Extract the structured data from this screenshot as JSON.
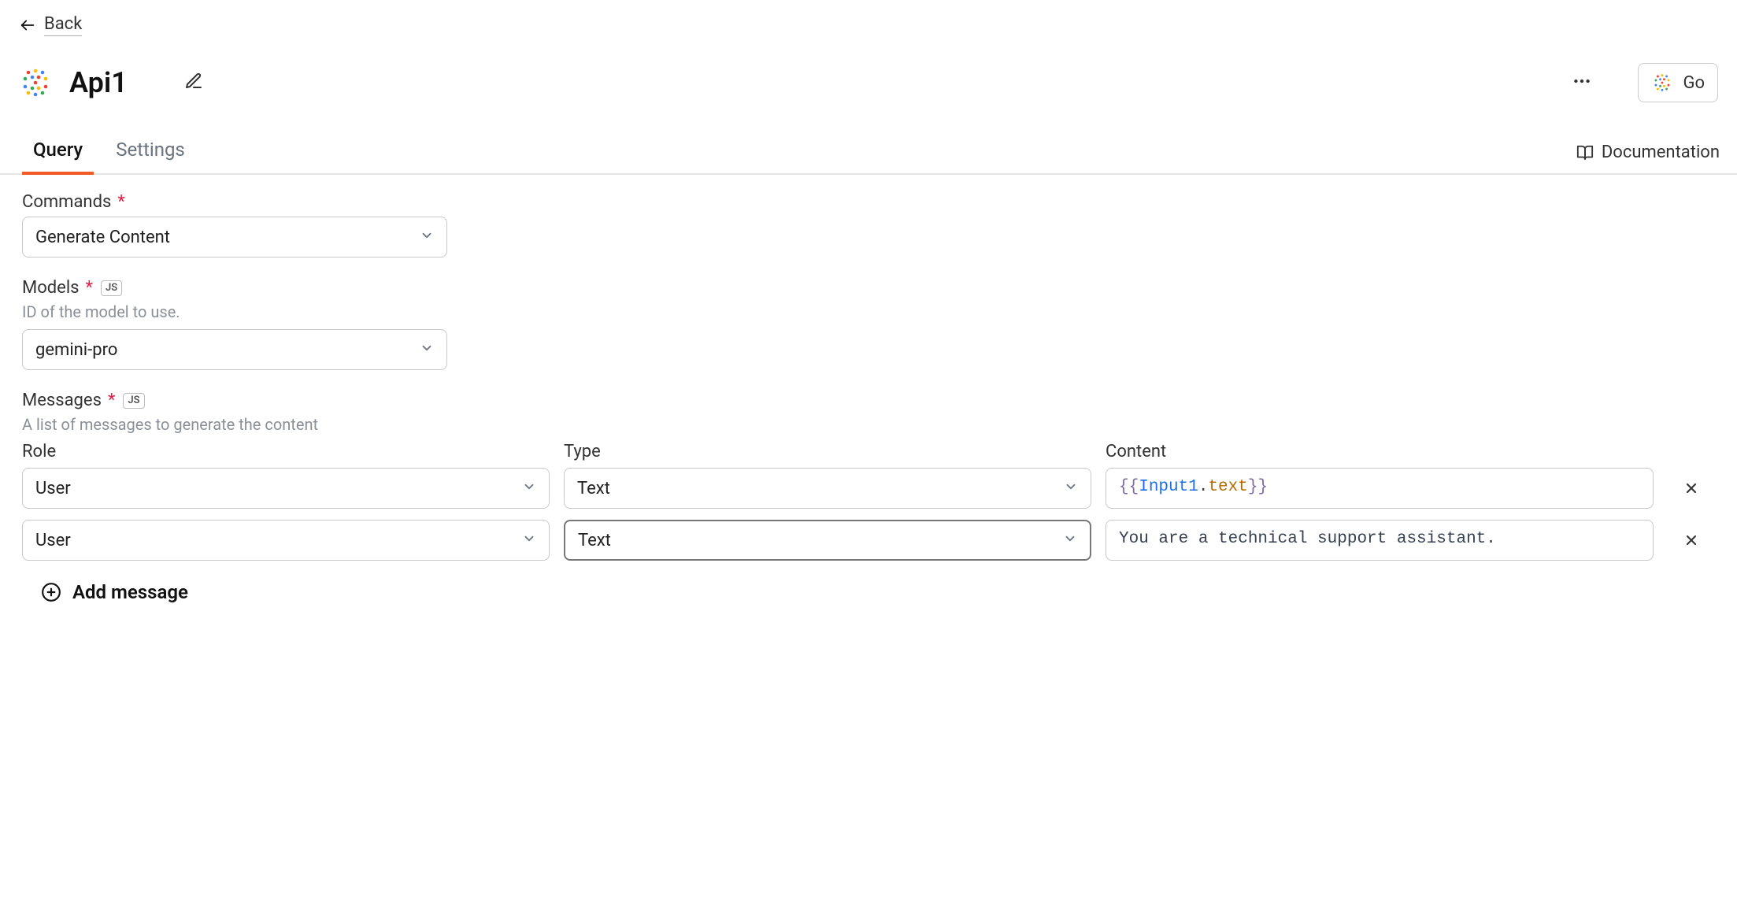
{
  "back_label": "Back",
  "api_name": "Api1",
  "provider_button_label": "Go",
  "tabs": {
    "query": "Query",
    "settings": "Settings"
  },
  "documentation_label": "Documentation",
  "commands": {
    "label": "Commands",
    "selected": "Generate Content"
  },
  "models": {
    "label": "Models",
    "help": "ID of the model to use.",
    "selected": "gemini-pro",
    "js_badge": "JS"
  },
  "messages": {
    "label": "Messages",
    "help": "A list of messages to generate the content",
    "js_badge": "JS",
    "columns": {
      "role": "Role",
      "type": "Type",
      "content": "Content"
    },
    "rows": [
      {
        "role": "User",
        "type": "Text",
        "content_display": "{{Input1.text}}",
        "content_template": {
          "obj": "Input1",
          "prop": "text"
        }
      },
      {
        "role": "User",
        "type": "Text",
        "content_display": "You are a technical support assistant."
      }
    ],
    "add_label": "Add message"
  }
}
